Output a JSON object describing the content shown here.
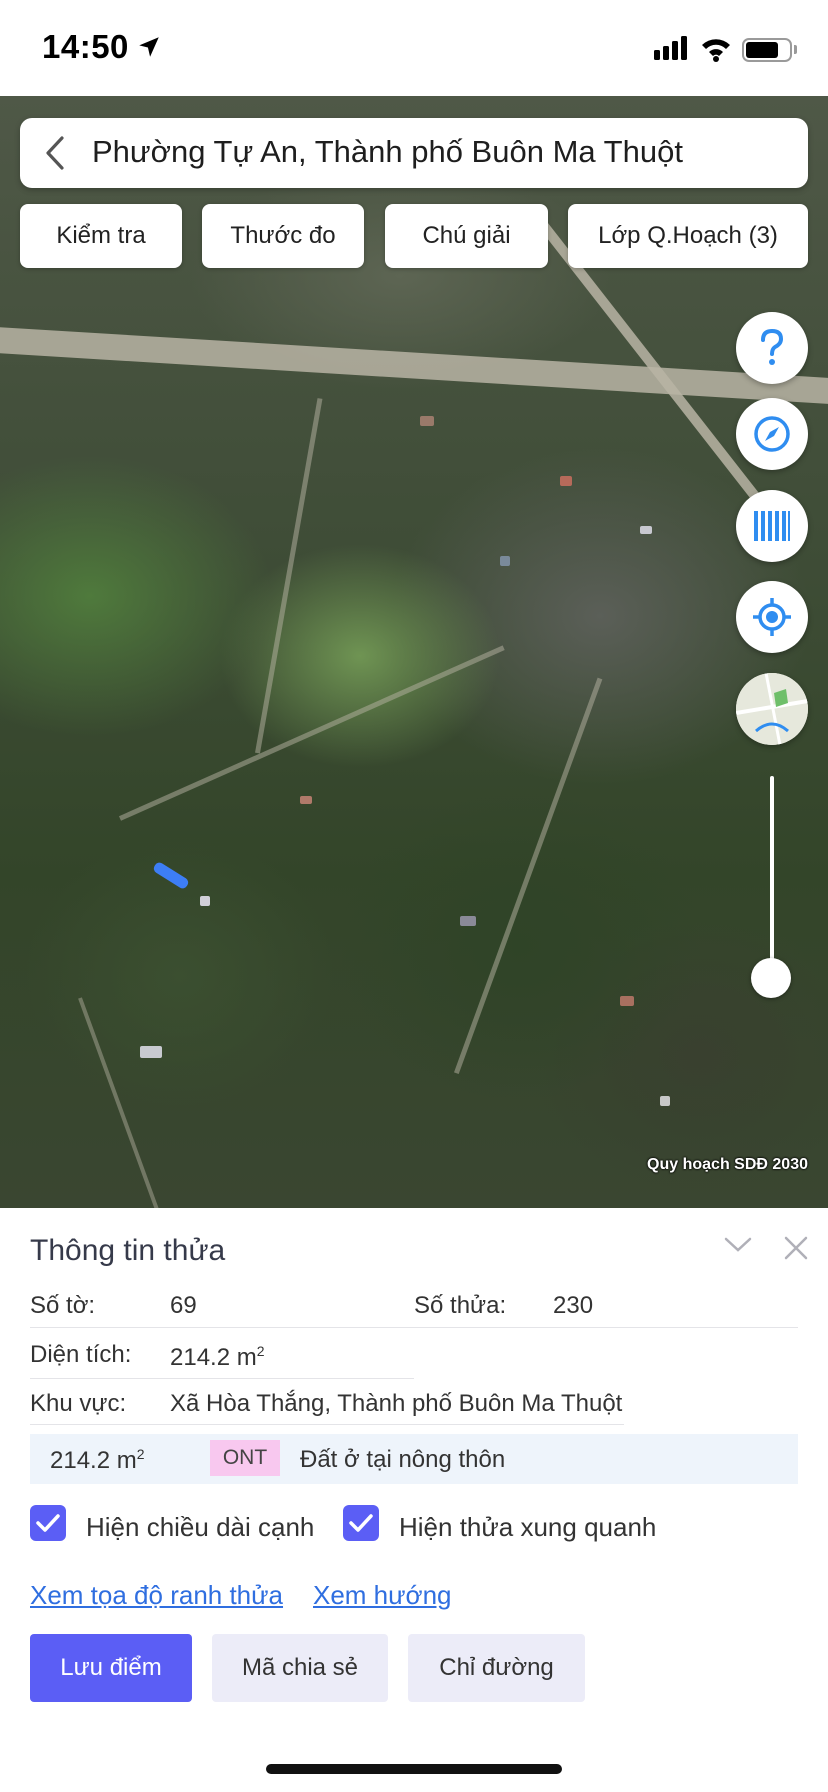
{
  "status_bar": {
    "time": "14:50"
  },
  "search": {
    "title": "Phường Tự An, Thành phố Buôn Ma Thuột"
  },
  "toolbar": {
    "check_label": "Kiểm tra",
    "measure_label": "Thước đo",
    "legend_label": "Chú giải",
    "layers_label": "Lớp Q.Hoạch (3)"
  },
  "map": {
    "credit": "Quy hoạch SDĐ 2030",
    "parcel_color": "#3d7ef5",
    "zoom_level": 0.1
  },
  "panel": {
    "title": "Thông tin thửa",
    "sheet_label": "Số tờ:",
    "sheet_value": "69",
    "parcel_label": "Số thửa:",
    "parcel_value": "230",
    "area_label": "Diện tích:",
    "area_value": "214.2 m",
    "area_unit_sup": "2",
    "region_label": "Khu vực:",
    "region_value": "Xã Hòa Thắng, Thành phố Buôn Ma Thuột",
    "landuse": {
      "area": "214.2 m",
      "area_sup": "2",
      "code": "ONT",
      "description": "Đất ở tại nông thôn",
      "code_color": "#f8c8ef"
    },
    "show_edge_length_label": "Hiện chiều dài cạnh",
    "show_neighbors_label": "Hiện thửa xung quanh",
    "view_coords_link": "Xem tọa độ ranh thửa",
    "view_direction_link": "Xem hướng",
    "save_button": "Lưu điểm",
    "share_button": "Mã chia sẻ",
    "directions_button": "Chỉ đường"
  },
  "colors": {
    "accent": "#5b5ef5",
    "link": "#2f6ee0",
    "fab_icon": "#2f8df0"
  }
}
